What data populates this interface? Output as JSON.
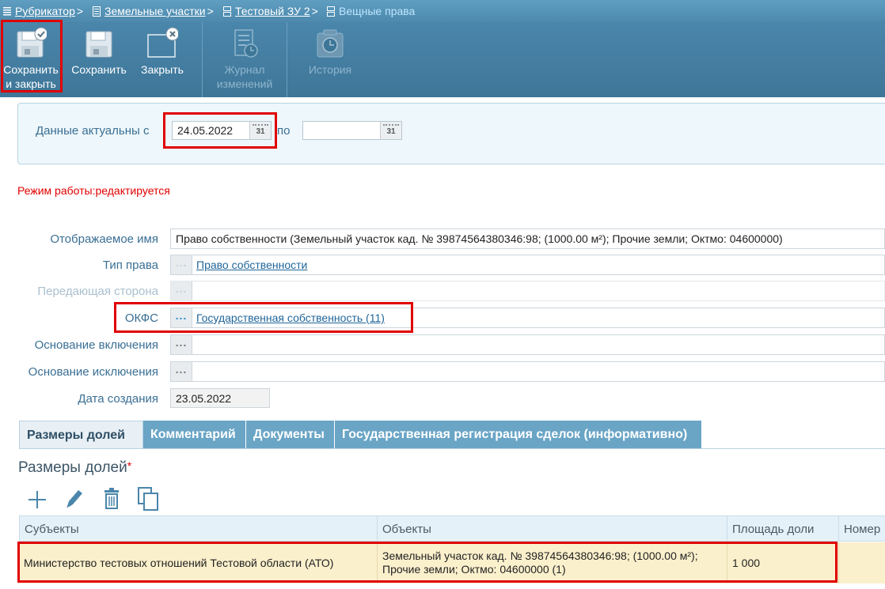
{
  "breadcrumb": {
    "items": [
      "Рубрикатор",
      "Земельные участки",
      "Тестовый ЗУ 2"
    ],
    "current": "Вещные права",
    "separator": ">"
  },
  "toolbar": {
    "save_close": {
      "line1": "Сохранить",
      "line2": "и закрыть"
    },
    "save": "Сохранить",
    "close": "Закрыть",
    "journal": {
      "line1": "Журнал",
      "line2": "изменений"
    },
    "history": "История"
  },
  "dates": {
    "from_label": "Данные актуальны с",
    "from_value": "24.05.2022",
    "to_label": "по",
    "to_value": "",
    "calendar_text": "31"
  },
  "mode_text": "Режим работы:редактируется",
  "form": {
    "display_name_label": "Отображаемое имя",
    "display_name_value": "Право собственности (Земельный участок  кад. № 39874564380346:98; (1000.00 м²); Прочие земли; Октмо: 04600000)",
    "right_type_label": "Тип права",
    "right_type_value": "Право собственности",
    "transferring_party_label": "Передающая сторона",
    "okfs_label": "ОКФС",
    "okfs_value": "Государственная собственность (11)",
    "inclusion_basis_label": "Основание включения",
    "exclusion_basis_label": "Основание исключения",
    "created_label": "Дата создания",
    "created_value": "23.05.2022",
    "ellipsis": "..."
  },
  "tabs": [
    "Размеры долей",
    "Комментарий",
    "Документы",
    "Государственная регистрация сделок (информативно)"
  ],
  "section": {
    "title": "Размеры долей",
    "required_mark": "*"
  },
  "table": {
    "columns": [
      "Субъекты",
      "Объекты",
      "Площадь доли",
      "Номер"
    ],
    "rows": [
      {
        "subject": "Министерство тестовых отношений Тестовой области (АТО)",
        "object": "Земельный участок кад. № 39874564380346:98; (1000.00 м²); Прочие земли; Октмо: 04600000 (1)",
        "area": "1 000",
        "number": ""
      }
    ]
  },
  "colors": {
    "accent": "#4a86ab",
    "highlight": "#e00000",
    "row_selected": "#fbf0cc"
  }
}
